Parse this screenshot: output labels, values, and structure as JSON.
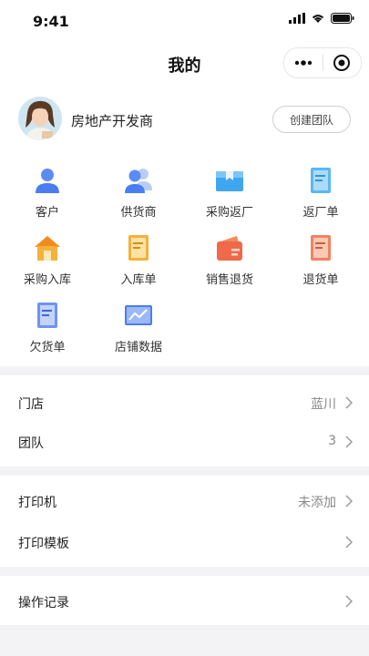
{
  "status_bar": {
    "time": "9:41"
  },
  "navbar": {
    "title": "我的"
  },
  "profile": {
    "name": "房地产开发商",
    "create_team": "创建团队"
  },
  "grid": [
    {
      "label": "客户",
      "icon": "customer-icon"
    },
    {
      "label": "供货商",
      "icon": "supplier-icon"
    },
    {
      "label": "采购返厂",
      "icon": "purchase-return-icon"
    },
    {
      "label": "返厂单",
      "icon": "return-order-icon"
    },
    {
      "label": "采购入库",
      "icon": "purchase-stockin-icon"
    },
    {
      "label": "入库单",
      "icon": "stockin-order-icon"
    },
    {
      "label": "销售退货",
      "icon": "sales-return-icon"
    },
    {
      "label": "退货单",
      "icon": "refund-order-icon"
    },
    {
      "label": "欠货单",
      "icon": "backorder-icon"
    },
    {
      "label": "店铺数据",
      "icon": "shop-data-icon"
    }
  ],
  "settings": {
    "store": {
      "label": "门店",
      "value": "蓝川"
    },
    "team": {
      "label": "团队",
      "value": "3"
    },
    "printer": {
      "label": "打印机",
      "value": "未添加"
    },
    "print_template": {
      "label": "打印模板"
    },
    "operation_log": {
      "label": "操作记录"
    }
  },
  "colors": {
    "accent_blue": "#4a7df0",
    "orange": "#f5a623",
    "red": "#f06a4a",
    "divider": "#f3f3f5"
  }
}
